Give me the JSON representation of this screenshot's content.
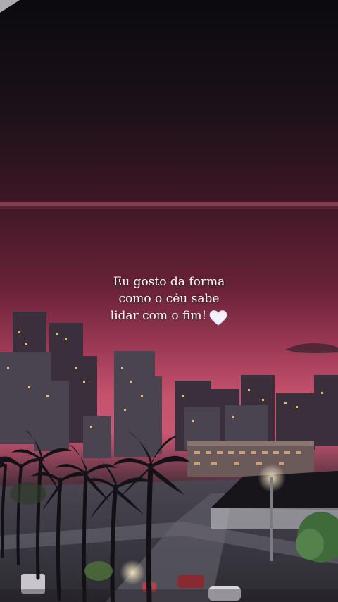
{
  "story": {
    "caption_lines": [
      "Eu gosto da forma",
      "como o céu sabe",
      "lidar com o fim!"
    ],
    "emoji": "white-heart-icon"
  },
  "colors": {
    "sky_top": "#0d0b12",
    "sky_mid": "#4a1a2c",
    "sky_glow": "#b04868",
    "horizon": "#d7607a",
    "heart": "#f4f0fb"
  }
}
